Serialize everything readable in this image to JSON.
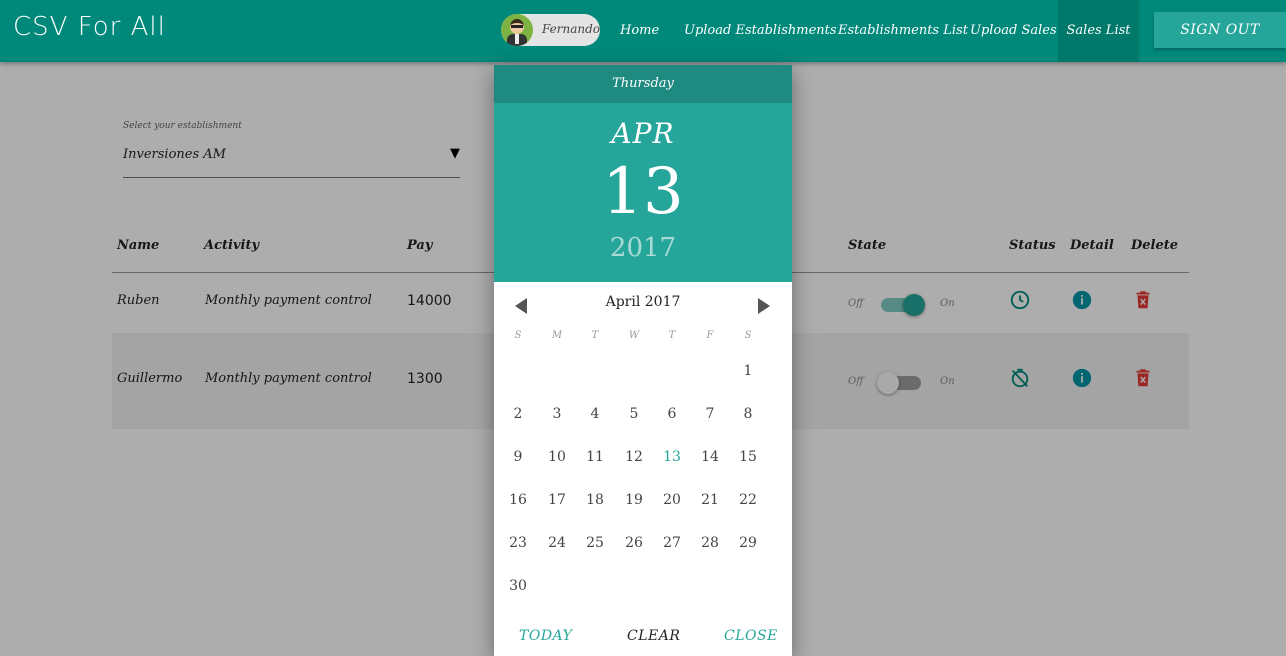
{
  "navbar": {
    "brand": "CSV For All",
    "user_name": "Fernando",
    "links": [
      "Home",
      "Upload Establishments",
      "Establishments List",
      "Upload Sales",
      "Sales List"
    ],
    "signout": "SIGN OUT",
    "color": "#00897b"
  },
  "establishment": {
    "label": "Select your establishment",
    "value": "Inversiones AM"
  },
  "table": {
    "headers": [
      "Name",
      "Activity",
      "Pay",
      "State",
      "Status",
      "Detail",
      "Delete"
    ],
    "rows": [
      {
        "name": "Ruben",
        "activity": "Monthly payment control",
        "pay": "14000",
        "state_off": "Off",
        "state_on": "On",
        "state": "on",
        "status_icon": "clock-icon"
      },
      {
        "name": "Guillermo",
        "activity": "Monthly payment control",
        "pay": "1300",
        "state_off": "Off",
        "state_on": "On",
        "state": "off",
        "status_icon": "timer-off-icon"
      }
    ]
  },
  "datepicker": {
    "weekday": "Thursday",
    "month_short": "APR",
    "day": "13",
    "year": "2017",
    "month_year": "April  2017",
    "weekday_letters": [
      "S",
      "M",
      "T",
      "W",
      "T",
      "F",
      "S"
    ],
    "first_weekday_index": 6,
    "days_in_month": 30,
    "selected_day": 13,
    "buttons": {
      "today": "TODAY",
      "clear": "CLEAR",
      "close": "CLOSE"
    },
    "accent": "#26a69a"
  }
}
